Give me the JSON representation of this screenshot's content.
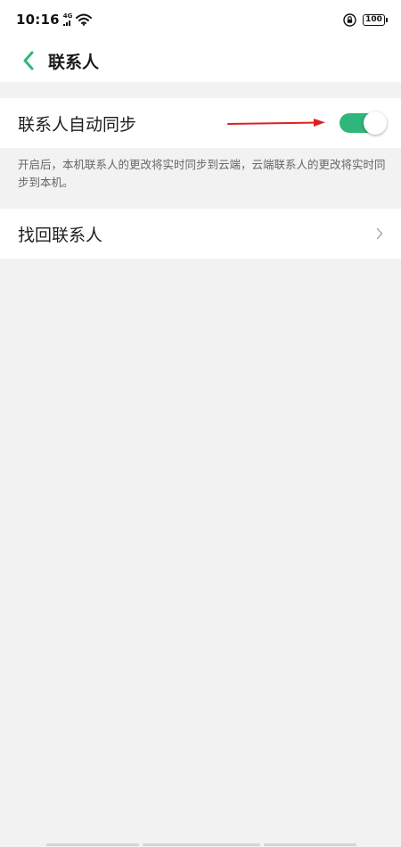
{
  "status_bar": {
    "time": "10:16",
    "network": "4G",
    "battery_text": "100"
  },
  "header": {
    "title": "联系人"
  },
  "sync": {
    "label": "联系人自动同步",
    "enabled": true,
    "description": "开启后，本机联系人的更改将实时同步到云端，云端联系人的更改将实时同步到本机。"
  },
  "recover": {
    "label": "找回联系人"
  },
  "colors": {
    "accent": "#2fb67a",
    "annotation_arrow": "#e02020",
    "background": "#f2f2f2",
    "card": "#ffffff"
  },
  "icons": [
    "back-arrow-icon",
    "wifi-icon",
    "lock-icon",
    "chevron-right-icon"
  ]
}
